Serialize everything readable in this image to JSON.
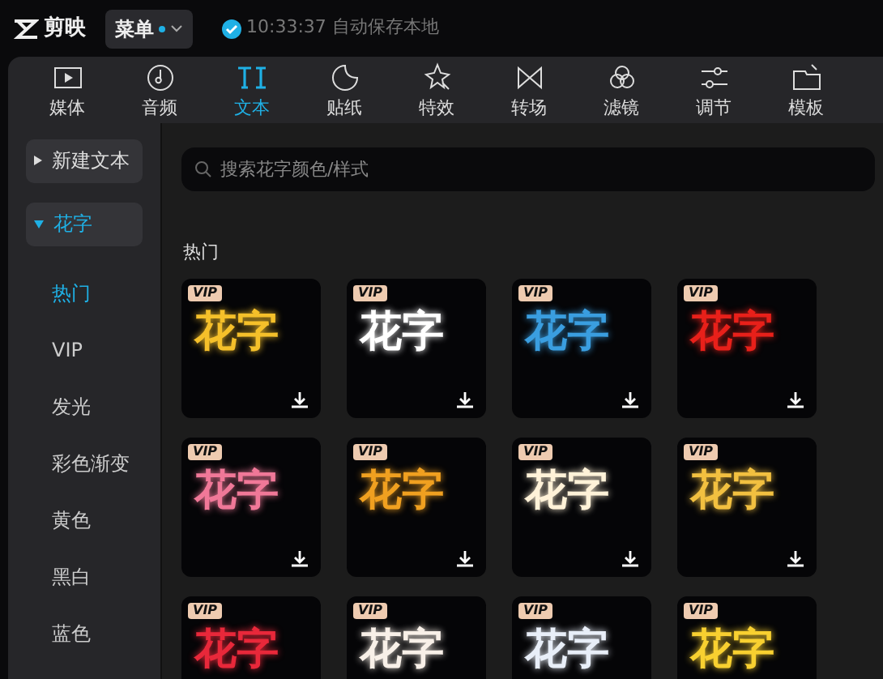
{
  "app": {
    "name": "剪映",
    "menu": "菜单",
    "menu_dot": true,
    "save_status": "10:33:37 自动保存本地"
  },
  "tabs": [
    {
      "label": "媒体",
      "selected": false
    },
    {
      "label": "音频",
      "selected": false
    },
    {
      "label": "文本",
      "selected": true
    },
    {
      "label": "贴纸",
      "selected": false
    },
    {
      "label": "特效",
      "selected": false
    },
    {
      "label": "转场",
      "selected": false
    },
    {
      "label": "滤镜",
      "selected": false
    },
    {
      "label": "调节",
      "selected": false
    },
    {
      "label": "模板",
      "selected": false
    }
  ],
  "sidebar": {
    "groups": [
      {
        "label": "新建文本",
        "expanded": false
      },
      {
        "label": "花字",
        "expanded": true,
        "children": [
          {
            "label": "热门",
            "selected": true
          },
          {
            "label": "VIP",
            "selected": false
          },
          {
            "label": "发光",
            "selected": false
          },
          {
            "label": "彩色渐变",
            "selected": false
          },
          {
            "label": "黄色",
            "selected": false
          },
          {
            "label": "黑白",
            "selected": false
          },
          {
            "label": "蓝色",
            "selected": false
          }
        ]
      }
    ]
  },
  "search": {
    "placeholder": "搜索花字颜色/样式"
  },
  "section_title": "热门",
  "styles": [
    {
      "badge": "VIP",
      "text": "花字",
      "color": "#f5c02a"
    },
    {
      "badge": "VIP",
      "text": "花字",
      "color": "#ffffff"
    },
    {
      "badge": "VIP",
      "text": "花字",
      "color": "#3a9ee0"
    },
    {
      "badge": "VIP",
      "text": "花字",
      "color": "#e8201a"
    },
    {
      "badge": "VIP",
      "text": "花字",
      "color": "#f07898"
    },
    {
      "badge": "VIP",
      "text": "花字",
      "color": "#f0a020"
    },
    {
      "badge": "VIP",
      "text": "花字",
      "color": "#fff2d8"
    },
    {
      "badge": "VIP",
      "text": "花字",
      "color": "#f2c040"
    },
    {
      "badge": "VIP",
      "text": "花字",
      "color": "#e8283a"
    },
    {
      "badge": "VIP",
      "text": "花字",
      "color": "#f8f0e8"
    },
    {
      "badge": "VIP",
      "text": "花字",
      "color": "#e8eef8"
    },
    {
      "badge": "VIP",
      "text": "花字",
      "color": "#f8d030"
    }
  ]
}
